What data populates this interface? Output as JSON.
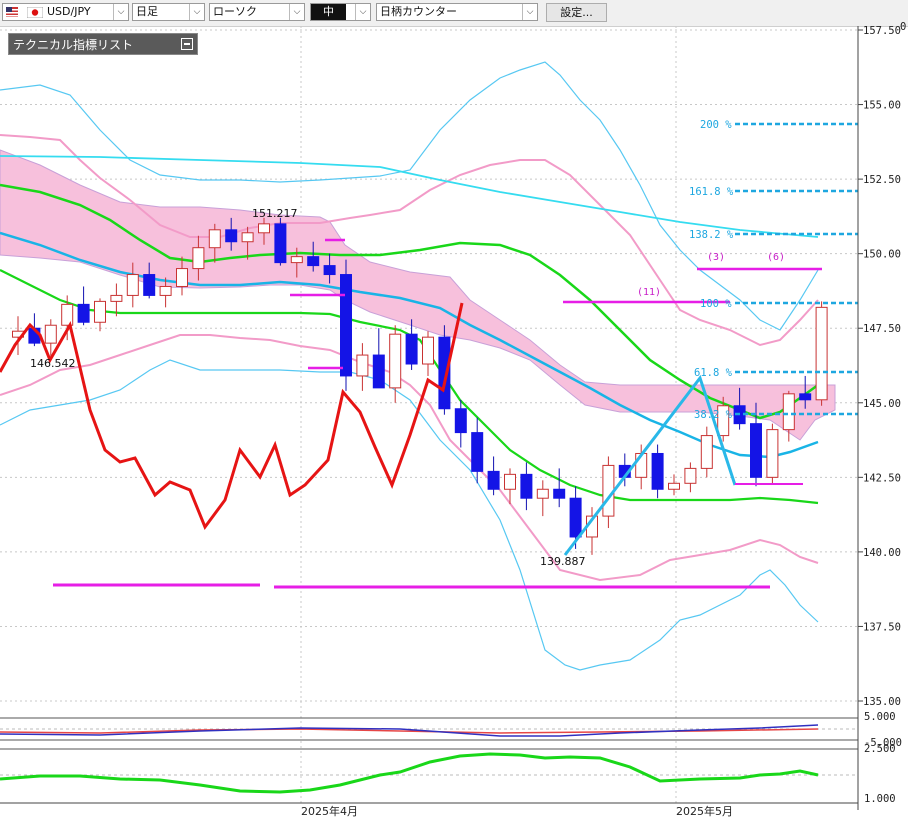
{
  "toolbar": {
    "symbol": "USD/JPY",
    "timeframe": "日足",
    "chart_type": "ローソク",
    "size": "中",
    "indicator_name": "日柄カウンター",
    "settings_label": "設定..."
  },
  "indicator_panel": {
    "title": "テクニカル指標リスト"
  },
  "price_axis": {
    "labels": [
      "157.50",
      "155.00",
      "152.50",
      "150.00",
      "147.50",
      "145.00",
      "142.50",
      "140.00",
      "137.50",
      "135.00"
    ],
    "overlap_marker": "0"
  },
  "sub_axis_1": {
    "labels": [
      "5.000",
      "-5.000"
    ]
  },
  "sub_axis_2": {
    "labels": [
      "2.500",
      "1.000"
    ]
  },
  "date_axis": {
    "labels": [
      "2025年4月",
      "2025年5月"
    ]
  },
  "annotations": {
    "high_label": "151.217",
    "low_label_left": "146.542",
    "low_label": "139.887"
  },
  "fibonacci": {
    "levels": [
      "200 %",
      "161.8 %",
      "138.2 %",
      "100 %",
      "61.8 %",
      "38.2 %"
    ]
  },
  "day_counters": [
    "(11)",
    "(3)",
    "(6)"
  ],
  "colors": {
    "up_candle": "#e64646",
    "down_candle": "#1414e6",
    "bollinger": "#57c8f2",
    "ichimoku_cloud": "#f7c0dc",
    "fib_lines": "#1ea7e0",
    "count_lines": "#e61ee6",
    "macd_line": "#e61414",
    "ma_green": "#19d719",
    "ma_blue": "#19b4e6"
  }
}
